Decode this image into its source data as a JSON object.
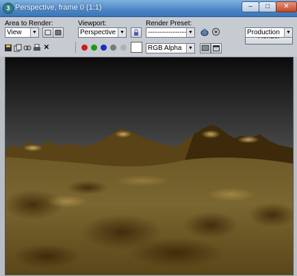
{
  "window": {
    "title": "Perspective, frame 0 (1:1)",
    "minimize_glyph": "–",
    "maximize_glyph": "□",
    "close_glyph": "✕"
  },
  "toolbar": {
    "area_to_render_label": "Area to Render:",
    "area_to_render_value": "View",
    "viewport_label": "Viewport:",
    "viewport_value": "Perspective",
    "render_preset_label": "Render Preset:",
    "render_preset_value": "--------------------",
    "render_button_label": "Render",
    "production_value": "Production",
    "channel_value": "RGB Alpha",
    "colors": {
      "red_channel": "#d11a1a",
      "green_channel": "#1a9a1a",
      "blue_channel": "#1a2fbf",
      "alpha_channel": "#7a7a7a"
    }
  },
  "icons": {
    "save": "save-icon",
    "copy": "copy-icon",
    "clone": "clone-icon",
    "print": "print-icon",
    "clear": "clear-icon"
  }
}
